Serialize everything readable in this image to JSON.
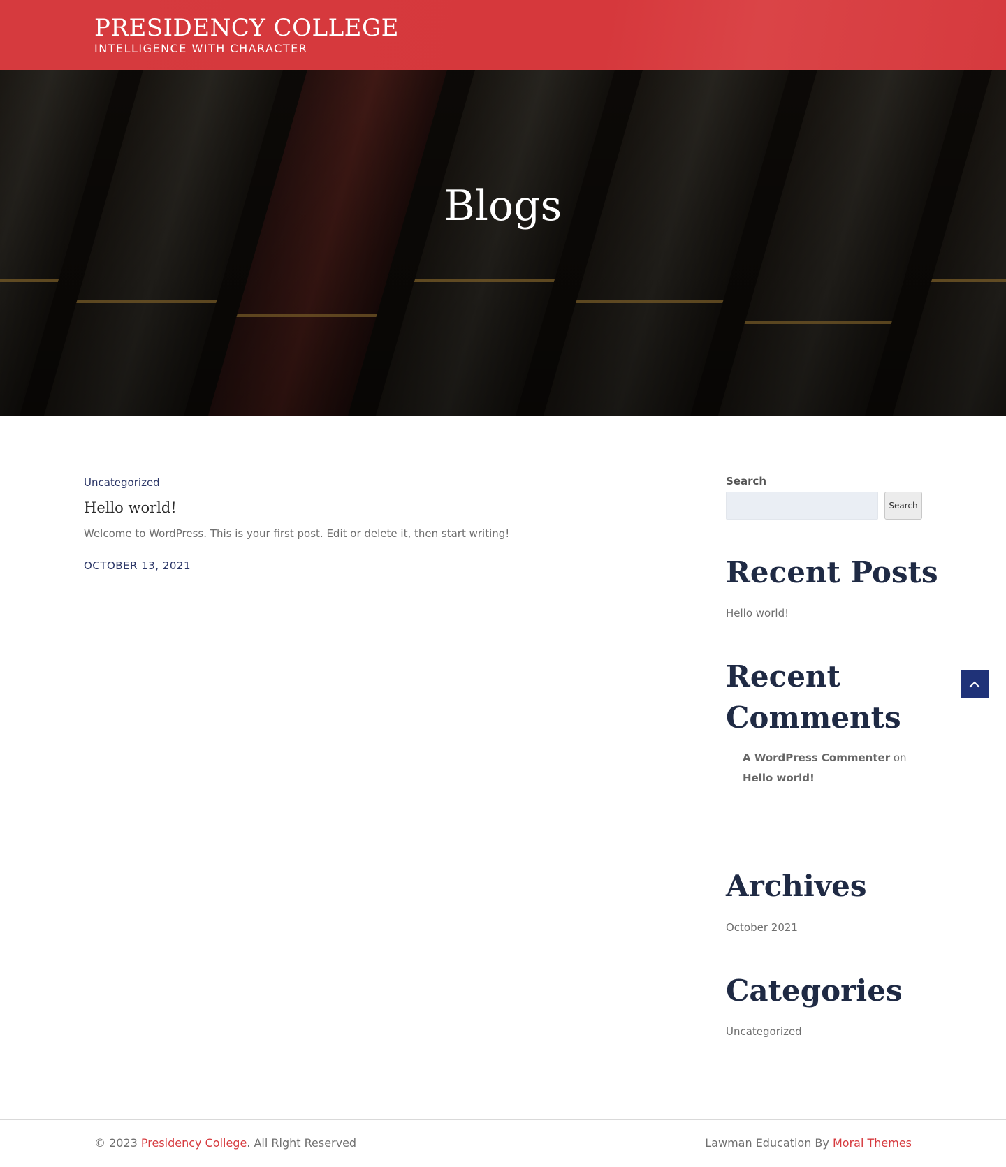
{
  "header": {
    "site_title": "PRESIDENCY COLLEGE",
    "tagline": "INTELLIGENCE WITH CHARACTER",
    "brand_color": "#d63a3e"
  },
  "hero": {
    "title": "Blogs"
  },
  "post": {
    "category": "Uncategorized",
    "title": "Hello world!",
    "excerpt": "Welcome to WordPress. This is your first post. Edit or delete it, then start writing!",
    "date": "OCTOBER 13, 2021"
  },
  "sidebar": {
    "search": {
      "label": "Search",
      "value": "",
      "button_label": "Search"
    },
    "recent_posts": {
      "title": "Recent Posts",
      "items": [
        "Hello world!"
      ]
    },
    "recent_comments": {
      "title_line1": "Recent",
      "title_line2": "Comments",
      "items": [
        {
          "author": "A WordPress Commenter",
          "connector": "on",
          "post": "Hello world!"
        }
      ]
    },
    "archives": {
      "title": "Archives",
      "items": [
        "October 2021"
      ]
    },
    "categories": {
      "title": "Categories",
      "items": [
        "Uncategorized"
      ]
    }
  },
  "scroll_top": {
    "icon": "chevron-up-icon",
    "color": "#1f3278"
  },
  "footer": {
    "copyright_prefix": "© 2023 ",
    "college_link": "Presidency College",
    "copyright_suffix": ". All Right Reserved",
    "credit_prefix": "Lawman Education By ",
    "credit_link": "Moral Themes"
  }
}
